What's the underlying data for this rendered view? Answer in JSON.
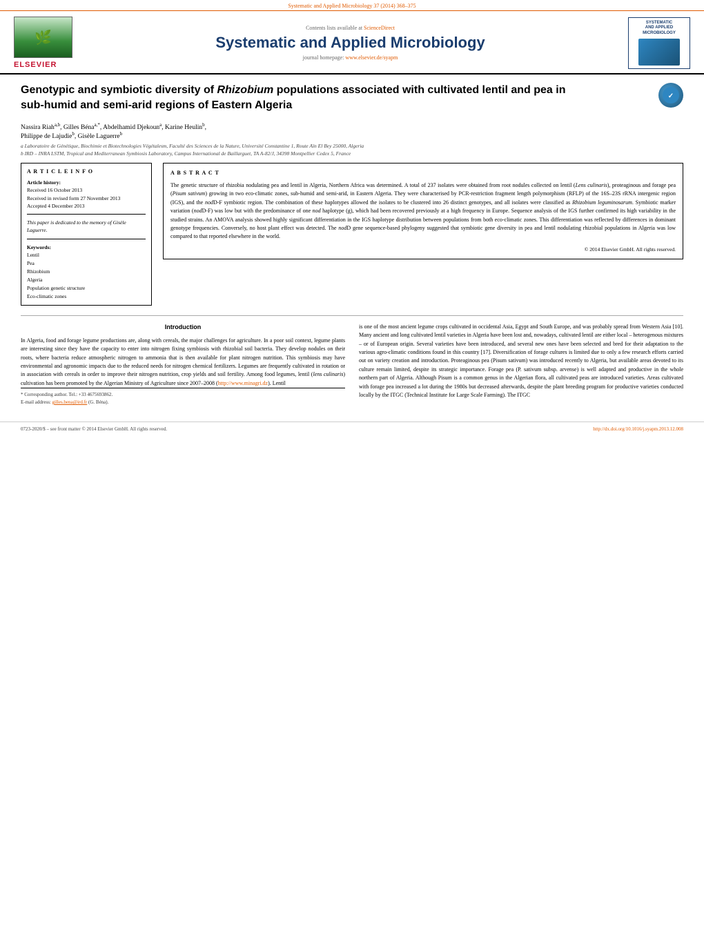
{
  "top_bar": {
    "text": "Systematic and Applied Microbiology 37 (2014) 368–375"
  },
  "journal_header": {
    "sciencedirect_prefix": "Contents lists available at ",
    "sciencedirect_link": "ScienceDirect",
    "sciencedirect_url": "#",
    "journal_title": "Systematic and Applied Microbiology",
    "homepage_prefix": "journal homepage: ",
    "homepage_url": "www.elsevier.de/syapm",
    "homepage_href": "#",
    "elsevier_label": "ELSEVIER",
    "journal_logo_title": "SYSTEMATIC\nAND APPLIED\nMICROBIOLOGY"
  },
  "article": {
    "title": "Genotypic and symbiotic diversity of Rhizobium populations associated with cultivated lentil and pea in sub-humid and semi-arid regions of Eastern Algeria",
    "title_italic_word": "Rhizobium",
    "authors": "Nassira Riah a,b, Gilles Béna a,*, Abdelhamid Djekoun a, Karine Heulin b, Philippe de Lajudie b, Gisèle Laguerre b",
    "affiliation_a": "a Laboratoire de Génétique, Biochimie et Biotechnologies Végétalesm, Faculté des Sciences de la Nature, Université Constantine 1, Route Aïn El Bey 25000, Algeria",
    "affiliation_b": "b IRD – INRA LSTM, Tropical and Mediterranean Symbiosis Laboratory, Campus International de Baillarguet, TA A-82/J, 34398 Montpellier Cedex 5, France"
  },
  "article_info": {
    "section_title": "A R T I C L E   I N F O",
    "history_title": "Article history:",
    "received": "Received 16 October 2013",
    "received_revised": "Received in revised form 27 November 2013",
    "accepted": "Accepted 4 December 2013",
    "dedication": "This paper is dedicated to the memory of Gisèle Laguerre.",
    "keywords_title": "Keywords:",
    "keywords": [
      "Lentil",
      "Pea",
      "Rhizobium",
      "Algeria",
      "Population genetic structure",
      "Eco-climatic zones"
    ]
  },
  "abstract": {
    "section_title": "A B S T R A C T",
    "text": "The genetic structure of rhizobia nodulating pea and lentil in Algeria, Northern Africa was determined. A total of 237 isolates were obtained from root nodules collected on lentil (Lens culinaris), proteaginous and forage pea (Pisum sativum) growing in two eco-climatic zones, sub-humid and semi-arid, in Eastern Algeria. They were characterised by PCR-restriction fragment length polymorphism (RFLP) of the 16S–23S rRNA intergenic region (IGS), and the nodD-F symbiotic region. The combination of these haplotypes allowed the isolates to be clustered into 26 distinct genotypes, and all isolates were classified as Rhizobium leguminosarum. Symbiotic marker variation (nodD-F) was low but with the predominance of one nod haplotype (g), which had been recovered previously at a high frequency in Europe. Sequence analysis of the IGS further confirmed its high variability in the studied strains. An AMOVA analysis showed highly significant differentiation in the IGS haplotype distribution between populations from both eco-climatic zones. This differentiation was reflected by differences in dominant genotype frequencies. Conversely, no host plant effect was detected. The nodD gene sequence-based phylogeny suggested that symbiotic gene diversity in pea and lentil nodulating rhizobial populations in Algeria was low compared to that reported elsewhere in the world.",
    "copyright": "© 2014 Elsevier GmbH. All rights reserved."
  },
  "intro": {
    "title": "Introduction",
    "left_col": "In Algeria, food and forage legume productions are, along with cereals, the major challenges for agriculture. In a poor soil context, legume plants are interesting since they have the capacity to enter into nitrogen fixing symbiosis with rhizobial soil bacteria. They develop nodules on their roots, where bacteria reduce atmospheric nitrogen to ammonia that is then available for plant nitrogen nutrition. This symbiosis may have environmental and agronomic impacts due to the reduced needs for nitrogen chemical fertilizers. Legumes are frequently cultivated in rotation or in association with cereals in order to improve their nitrogen nutrition, crop yields and soil fertility. Among food legumes, lentil (lens culinaris) cultivation has been promoted by the Algerian Ministry of Agriculture since 2007–2008 (http://www.minagri.dz). Lentil",
    "left_col_link": "http://www.minagri.dz",
    "right_col": "is one of the most ancient legume crops cultivated in occidental Asia, Egypt and South Europe, and was probably spread from Western Asia [10]. Many ancient and long cultivated lentil varieties in Algeria have been lost and, nowadays, cultivated lentil are either local – heterogenous mixtures – or of European origin. Several varieties have been introduced, and several new ones have been selected and bred for their adaptation to the various agro-climatic conditions found in this country [17]. Diversification of forage cultures is limited due to only a few research efforts carried out on variety creation and introduction. Proteaginous pea (Pisum sativum) was introduced recently to Algeria, but available areas devoted to its culture remain limited, despite its strategic importance. Forage pea (P. sativum subsp. arvense) is well adapted and productive in the whole northern part of Algeria. Although Pisum is a common genus in the Algerian flora, all cultivated peas are introduced varieties. Areas cultivated with forage pea increased a lot during the 1980s but decreased afterwards, despite the plant breeding program for productive varieties conducted locally by the ITGC (Technical Institute for Large Scale Farming). The ITGC"
  },
  "footnote": {
    "corresponding": "* Corresponding author. Tel.: +33 4675693862.",
    "email_label": "E-mail address: ",
    "email": "gilles.bena@ird.fr",
    "email_name": "(G. Béna)."
  },
  "footer": {
    "left": "0723-2020/$ – see front matter © 2014 Elsevier GmbH. All rights reserved.",
    "doi": "http://dx.doi.org/10.1016/j.syapm.2013.12.008",
    "doi_prefix": ""
  }
}
